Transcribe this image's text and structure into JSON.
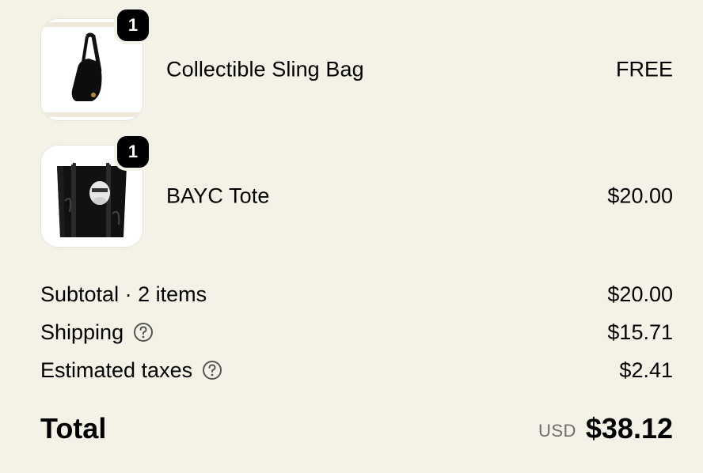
{
  "cart": {
    "items": [
      {
        "name": "Collectible Sling Bag",
        "price": "FREE",
        "quantity": "1",
        "image_icon": "sling-bag-image"
      },
      {
        "name": "BAYC Tote",
        "price": "$20.00",
        "quantity": "1",
        "image_icon": "tote-bag-image"
      }
    ]
  },
  "summary": {
    "subtotal_label": "Subtotal · 2 items",
    "subtotal_value": "$20.00",
    "shipping_label": "Shipping",
    "shipping_value": "$15.71",
    "taxes_label": "Estimated taxes",
    "taxes_value": "$2.41",
    "total_label": "Total",
    "currency": "USD",
    "total_value": "$38.12"
  },
  "colors": {
    "background": "#f4f1e7",
    "text": "#000000",
    "muted": "#6e6e6a",
    "badge": "#000000"
  }
}
